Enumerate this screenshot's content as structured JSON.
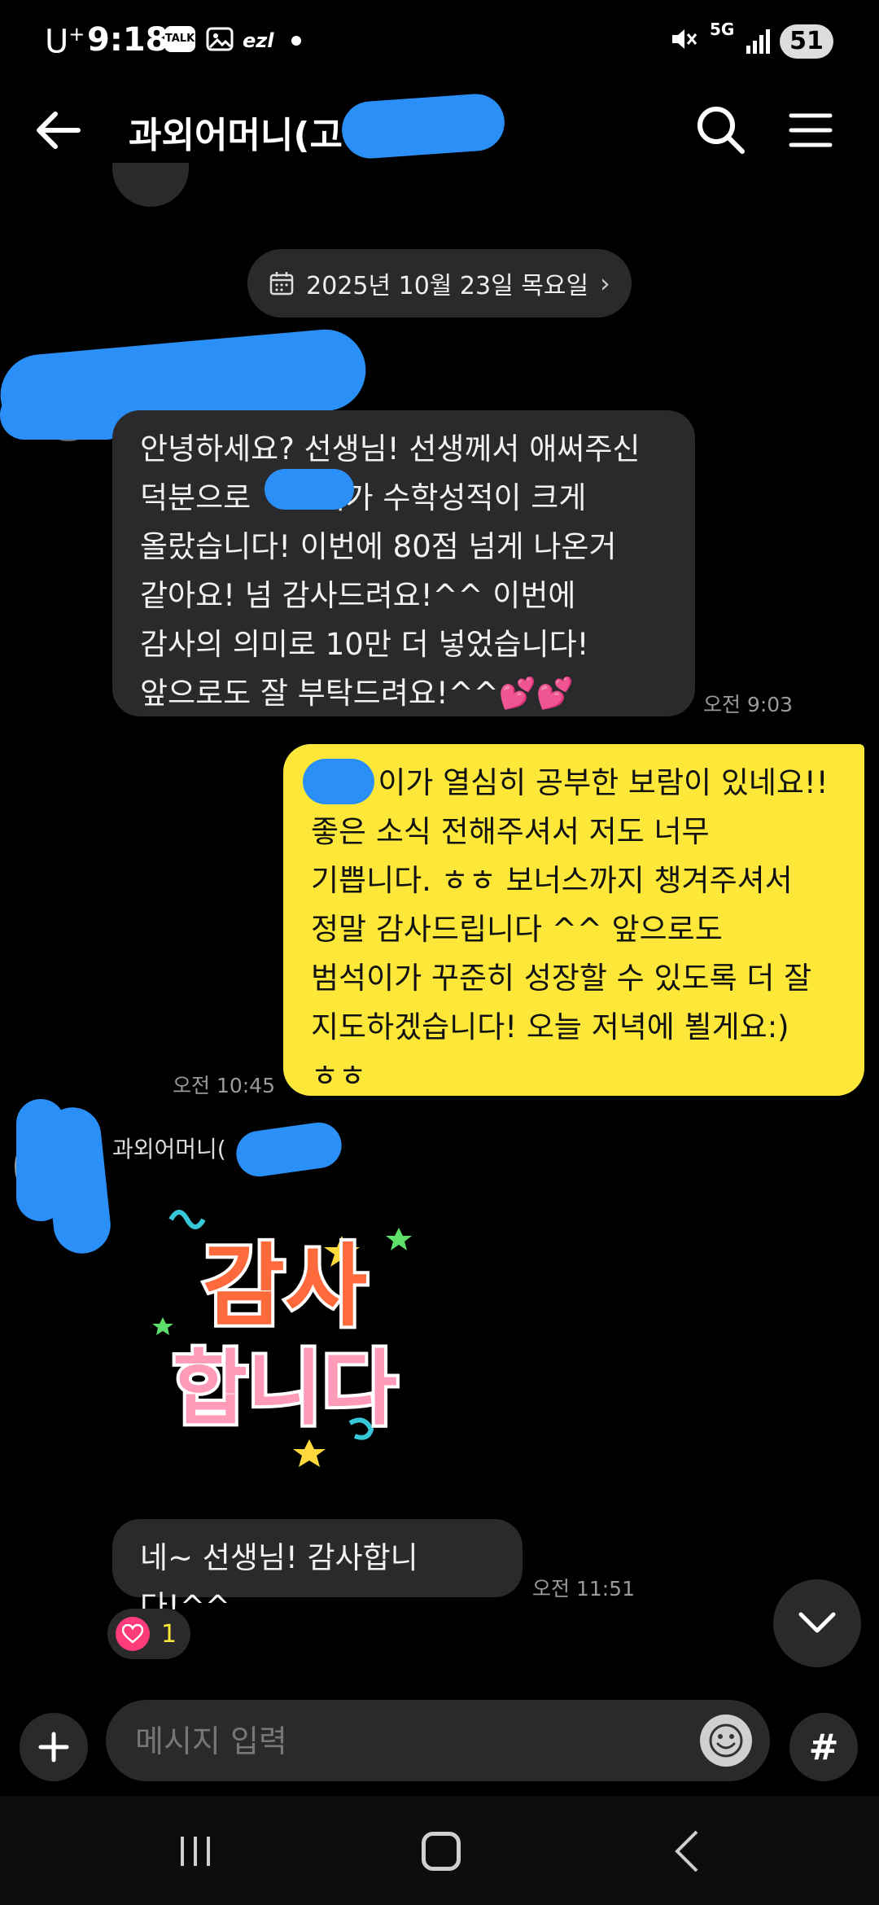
{
  "status_bar": {
    "carrier": "U",
    "carrier_sup": "+",
    "time": "9:18",
    "talk_icon_label": "TALK",
    "ezl": "ezl",
    "network": "5G",
    "battery": "51"
  },
  "header": {
    "title": "과외어머니(고 "
  },
  "date_pill": {
    "label": "2025년 10월 23일 목요일",
    "chevron": "›"
  },
  "messages": {
    "incoming_1": {
      "lines": [
        "안녕하세요? 선생님! 선생께서 애써주신",
        "덕분으로       이가 수학성적이 크게",
        "올랐습니다! 이번에 80점 넘게 나온거",
        "같아요! 넘 감사드려요!^^ 이번에",
        "감사의 의미로 10만 더 넣었습니다!",
        "앞으로도 잘 부탁드려요!^^💕💕"
      ],
      "time": "오전 9:03"
    },
    "outgoing_1": {
      "lines": [
        "       이가 열심히 공부한 보람이 있네요!!",
        "좋은 소식 전해주셔서 저도 너무",
        "기쁩니다. ㅎㅎ 보너스까지 챙겨주셔서",
        "정말 감사드립니다 ^^ 앞으로도",
        "범석이가 꾸준히 성장할 수 있도록 더 잘",
        "지도하겠습니다! 오늘 저녁에 뵐게요:)",
        "ㅎㅎ"
      ],
      "time": "오전 10:45"
    },
    "sender_name": "과외어머니(",
    "sender_name_end": ")",
    "sticker": {
      "line1": "감사",
      "line2": "합니다"
    },
    "incoming_2": {
      "text": "네~ 선생님! 감사합니다!^^",
      "time": "오전 11:51",
      "reaction_count": "1"
    }
  },
  "input": {
    "placeholder": "메시지 입력",
    "hash": "#"
  },
  "colors": {
    "outgoing_bubble": "#fde83a",
    "incoming_bubble": "#2a2a2c",
    "redaction": "#2a8ff7",
    "heart": "#ff3b7a"
  }
}
